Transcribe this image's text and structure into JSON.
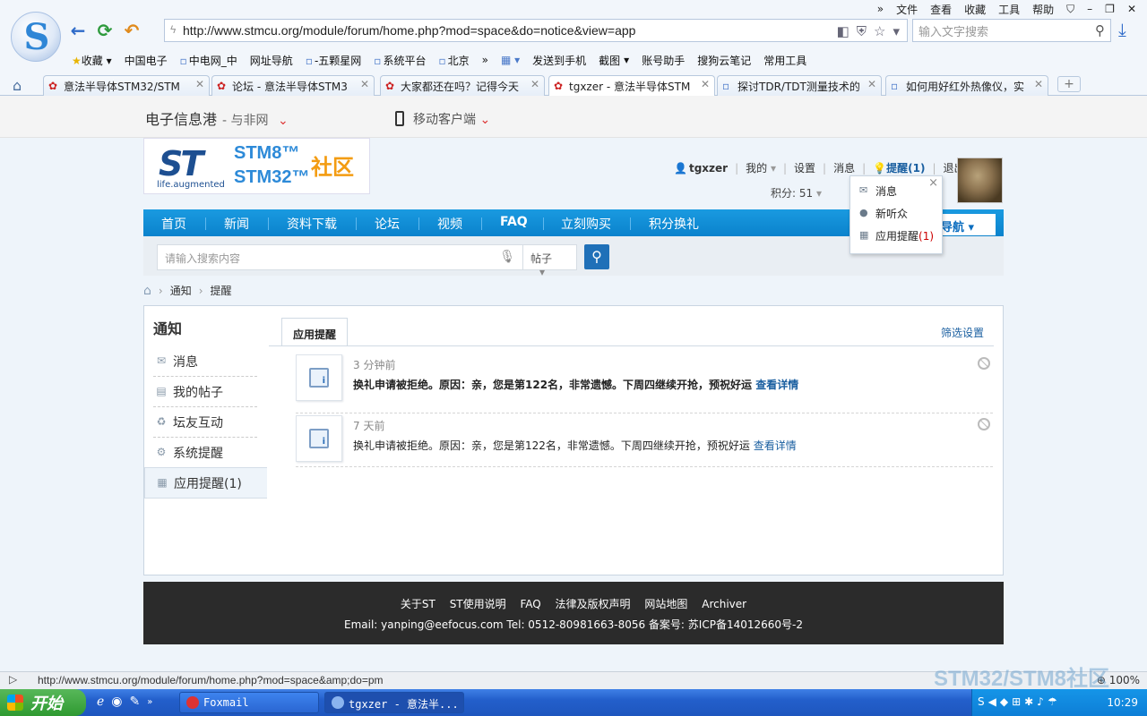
{
  "browser": {
    "menu": [
      "»",
      "文件",
      "查看",
      "收藏",
      "工具",
      "帮助"
    ],
    "address": "http://www.stmcu.org/module/forum/home.php?mod=space&do=notice&view=app",
    "search_placeholder": "输入文字搜索",
    "bookmarks": [
      "收藏",
      "中国电子",
      "中电网_中",
      "网址导航",
      "-五颗星网",
      "系统平台",
      "北京",
      "»",
      "发送到手机",
      "截图",
      "账号助手",
      "搜狗云笔记",
      "常用工具"
    ],
    "tabs": [
      {
        "title": "意法半导体STM32/STM"
      },
      {
        "title": "论坛 - 意法半导体STM3"
      },
      {
        "title": "大家都还在吗？记得今天"
      },
      {
        "title": "tgxzer - 意法半导体STM"
      },
      {
        "title": "探讨TDR/TDT测量技术的"
      },
      {
        "title": "如何用好红外热像仪，实"
      }
    ],
    "status_url": "http://www.stmcu.org/module/forum/home.php?mod=space&amp;do=pm",
    "zoom": "100%"
  },
  "site": {
    "title": "电子信息港",
    "subtitle": "- 与非网",
    "mobile": "移动客户端",
    "logo": {
      "st": "ST",
      "tagline": "life.augmented",
      "stm8": "STM8™",
      "stm32": "STM32™",
      "community": "社区"
    },
    "user": {
      "name": "tgxzer",
      "mine": "我的",
      "settings": "设置",
      "messages": "消息",
      "remind": "提醒(1)",
      "logout": "退出",
      "points": "积分: 51"
    },
    "nav": [
      "首页",
      "新闻",
      "资料下载",
      "论坛",
      "视频",
      "FAQ",
      "立刻购买",
      "积分换礼"
    ],
    "nav_more": "导航",
    "search_placeholder": "请输入搜索内容",
    "search_type": "帖子",
    "breadcrumb": [
      "通知",
      "提醒"
    ]
  },
  "dropdown": {
    "items": [
      "消息",
      "新听众",
      "应用提醒"
    ],
    "count": "(1)"
  },
  "sidebar": {
    "title": "通知",
    "items": [
      "消息",
      "我的帖子",
      "坛友互动",
      "系统提醒",
      "应用提醒(1)"
    ]
  },
  "main": {
    "tab": "应用提醒",
    "filter": "筛选设置",
    "notices": [
      {
        "time": "3 分钟前",
        "text": "换礼申请被拒绝。原因：亲，您是第122名，非常遗憾。下周四继续开抢，预祝好运",
        "link": "查看详情"
      },
      {
        "time": "7 天前",
        "text": "换礼申请被拒绝。原因：亲，您是第122名，非常遗憾。下周四继续开抢，预祝好运",
        "link": "查看详情"
      }
    ]
  },
  "footer": {
    "links": [
      "关于ST",
      "ST使用说明",
      "FAQ",
      "法律及版权声明",
      "网站地图",
      "Archiver"
    ],
    "contact": "Email:  yanping@eefocus.com   Tel: 0512-80981663-8056 备案号: 苏ICP备14012660号-2"
  },
  "watermark": "STM32/STM8社区",
  "taskbar": {
    "start": "开始",
    "tasks": [
      "Foxmail",
      "tgxzer - 意法半..."
    ],
    "clock": "10:29"
  }
}
